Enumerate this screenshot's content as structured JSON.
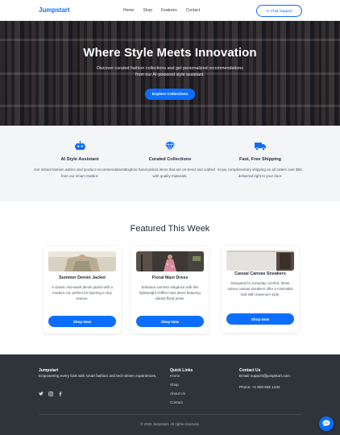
{
  "header": {
    "brand": "Jumpstart",
    "nav": [
      "Home",
      "Shop",
      "Features",
      "Contact"
    ],
    "chat_button": "AI Chat Support"
  },
  "hero": {
    "title": "Where Style Meets Innovation",
    "subtitle": "Discover curated fashion collections and get personalized recommendations from our AI-powered style assistant.",
    "button": "Explore Collections"
  },
  "features": [
    {
      "icon": "robot-icon",
      "title": "AI Style Assistant",
      "desc": "Get instant fashion advice and product recommendations from our smart chatbot."
    },
    {
      "icon": "gem-icon",
      "title": "Curated Collections",
      "desc": "Explore hand-picked items that are on-trend and crafted with quality materials."
    },
    {
      "icon": "truck-icon",
      "title": "Fast, Free Shipping",
      "desc": "Enjoy complimentary shipping on all orders over $50, delivered right to your door."
    }
  ],
  "featured": {
    "title": "Featured This Week",
    "products": [
      {
        "name": "Summer Denim Jacket",
        "desc": "A classic mid-wash denim jacket with a modern cut, perfect for layering in any season.",
        "button": "Shop Now"
      },
      {
        "name": "Floral Maxi Dress",
        "desc": "Embrace summer elegance with this lightweight chiffon maxi dress featuring vibrant floral prints.",
        "button": "Shop Now"
      },
      {
        "name": "Casual Canvas Sneakers",
        "desc": "Designed for everyday comfort, these unisex canvas sneakers offer a minimalist look with maximum style.",
        "button": "Shop Now"
      }
    ]
  },
  "footer": {
    "brand": "Jumpstart",
    "brand_desc": "Empowering every look with smart fashion and tech-driven experiences.",
    "social": [
      "twitter-icon",
      "instagram-icon",
      "facebook-icon"
    ],
    "links_title": "Quick Links",
    "links": [
      "Home",
      "Shop",
      "About Us",
      "Contact"
    ],
    "contact_title": "Contact Us",
    "email": "Email: support@jumpstart.com",
    "phone": "Phone: +1 800 555 1234",
    "copyright": "© 2025 Jumpstart. All rights reserved."
  },
  "colors": {
    "accent": "#0d6efd",
    "footer_bg": "#2f343a",
    "features_bg": "#f4f5f7"
  }
}
